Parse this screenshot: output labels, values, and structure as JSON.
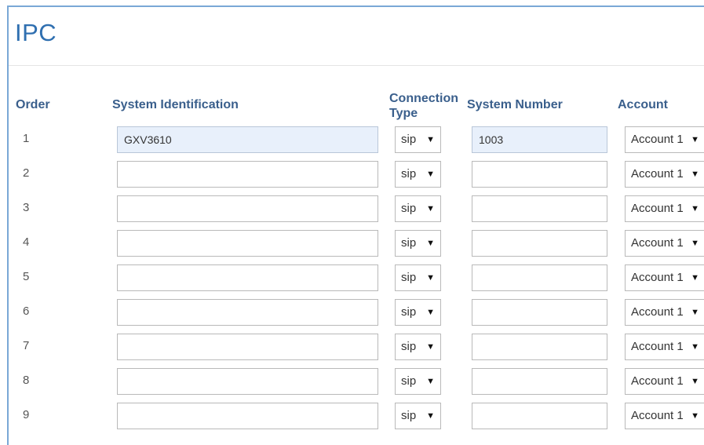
{
  "page": {
    "title": "IPC"
  },
  "headers": {
    "order": "Order",
    "system_identification": "System Identification",
    "connection_type_line1": "Connection",
    "connection_type_line2": "Type",
    "system_number": "System Number",
    "account": "Account"
  },
  "rows": [
    {
      "order": "1",
      "system_identification": "GXV3610",
      "connection_type": "sip",
      "system_number": "1003",
      "account": "Account 1"
    },
    {
      "order": "2",
      "system_identification": "",
      "connection_type": "sip",
      "system_number": "",
      "account": "Account 1"
    },
    {
      "order": "3",
      "system_identification": "",
      "connection_type": "sip",
      "system_number": "",
      "account": "Account 1"
    },
    {
      "order": "4",
      "system_identification": "",
      "connection_type": "sip",
      "system_number": "",
      "account": "Account 1"
    },
    {
      "order": "5",
      "system_identification": "",
      "connection_type": "sip",
      "system_number": "",
      "account": "Account 1"
    },
    {
      "order": "6",
      "system_identification": "",
      "connection_type": "sip",
      "system_number": "",
      "account": "Account 1"
    },
    {
      "order": "7",
      "system_identification": "",
      "connection_type": "sip",
      "system_number": "",
      "account": "Account 1"
    },
    {
      "order": "8",
      "system_identification": "",
      "connection_type": "sip",
      "system_number": "",
      "account": "Account 1"
    },
    {
      "order": "9",
      "system_identification": "",
      "connection_type": "sip",
      "system_number": "",
      "account": "Account 1"
    }
  ],
  "icons": {
    "dropdown": "caret-down-icon"
  },
  "colors": {
    "title": "#2f6fb0",
    "header_text": "#3a5f8c",
    "filled_input_bg": "#e8f0fb",
    "panel_border": "#7aa8d6"
  }
}
